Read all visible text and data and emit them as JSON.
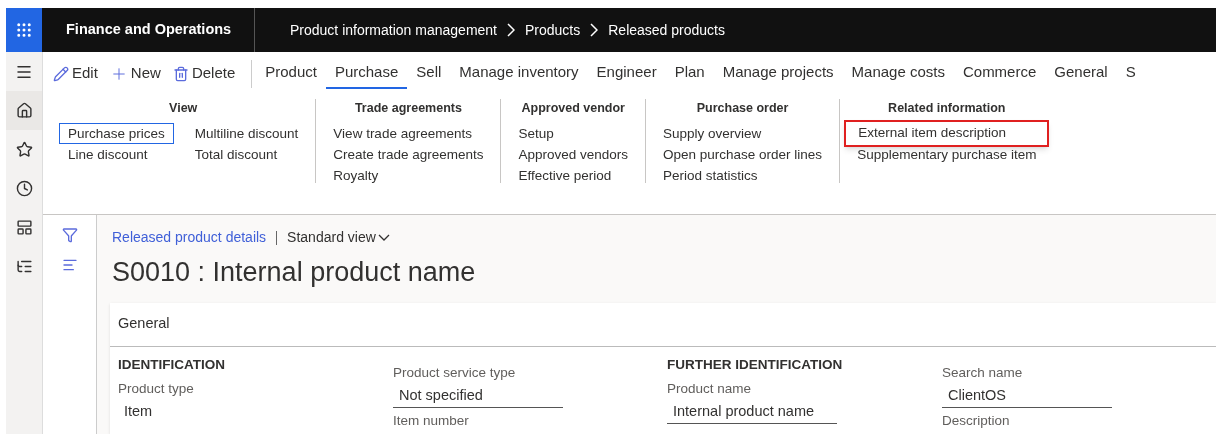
{
  "app": {
    "title": "Finance and Operations"
  },
  "breadcrumb": [
    "Product information management",
    "Products",
    "Released products"
  ],
  "nav_rail": [
    {
      "kind": "menu"
    },
    {
      "kind": "home"
    },
    {
      "kind": "star"
    },
    {
      "kind": "clock"
    },
    {
      "kind": "workspace"
    },
    {
      "kind": "list"
    }
  ],
  "actions": [
    {
      "kind": "edit",
      "label": "Edit"
    },
    {
      "kind": "new",
      "label": "New"
    },
    {
      "kind": "delete",
      "label": "Delete"
    }
  ],
  "tabs": [
    {
      "label": "Product",
      "selected": false
    },
    {
      "label": "Purchase",
      "selected": true
    },
    {
      "label": "Sell",
      "selected": false
    },
    {
      "label": "Manage inventory",
      "selected": false
    },
    {
      "label": "Engineer",
      "selected": false
    },
    {
      "label": "Plan",
      "selected": false
    },
    {
      "label": "Manage projects",
      "selected": false
    },
    {
      "label": "Manage costs",
      "selected": false
    },
    {
      "label": "Commerce",
      "selected": false
    },
    {
      "label": "General",
      "selected": false
    },
    {
      "label": "S",
      "selected": false
    }
  ],
  "ribbon_groups": [
    {
      "title": "View",
      "columns": [
        [
          {
            "label": "Purchase prices",
            "focused": true,
            "highlighted": false
          },
          {
            "label": "Line discount",
            "focused": false,
            "highlighted": false
          }
        ],
        [
          {
            "label": "Multiline discount",
            "focused": false,
            "highlighted": false
          },
          {
            "label": "Total discount",
            "focused": false,
            "highlighted": false
          }
        ]
      ]
    },
    {
      "title": "Trade agreements",
      "columns": [
        [
          {
            "label": "View trade agreements",
            "focused": false,
            "highlighted": false
          },
          {
            "label": "Create trade agreements",
            "focused": false,
            "highlighted": false
          },
          {
            "label": "Royalty",
            "focused": false,
            "highlighted": false
          }
        ]
      ]
    },
    {
      "title": "Approved vendor",
      "columns": [
        [
          {
            "label": "Setup",
            "focused": false,
            "highlighted": false
          },
          {
            "label": "Approved vendors",
            "focused": false,
            "highlighted": false
          },
          {
            "label": "Effective period",
            "focused": false,
            "highlighted": false
          }
        ]
      ]
    },
    {
      "title": "Purchase order",
      "columns": [
        [
          {
            "label": "Supply overview",
            "focused": false,
            "highlighted": false
          },
          {
            "label": "Open purchase order lines",
            "focused": false,
            "highlighted": false
          },
          {
            "label": "Period statistics",
            "focused": false,
            "highlighted": false
          }
        ]
      ]
    },
    {
      "title": "Related information",
      "columns": [
        [
          {
            "label": "External item description",
            "focused": false,
            "highlighted": true
          },
          {
            "label": "Supplementary purchase item",
            "focused": false,
            "highlighted": false
          }
        ]
      ]
    }
  ],
  "page": {
    "link": "Released product details",
    "view": "Standard view",
    "title": "S0010 : Internal product name"
  },
  "section": {
    "title": "General",
    "columns": [
      {
        "heading": "IDENTIFICATION",
        "fields": [
          {
            "label": "Product type",
            "value": "Item",
            "kind": "plain"
          }
        ]
      },
      {
        "fields": [
          {
            "label": "Product service type",
            "value": "Not specified",
            "kind": "input"
          },
          {
            "label": "Item number",
            "kind": "label"
          }
        ]
      },
      {
        "heading": "FURTHER IDENTIFICATION",
        "fields": [
          {
            "label": "Product name",
            "value": "Internal product name",
            "kind": "input"
          }
        ]
      },
      {
        "fields": [
          {
            "label": "Search name",
            "value": "ClientOS",
            "kind": "input"
          },
          {
            "label": "Description",
            "kind": "label"
          }
        ]
      }
    ]
  }
}
